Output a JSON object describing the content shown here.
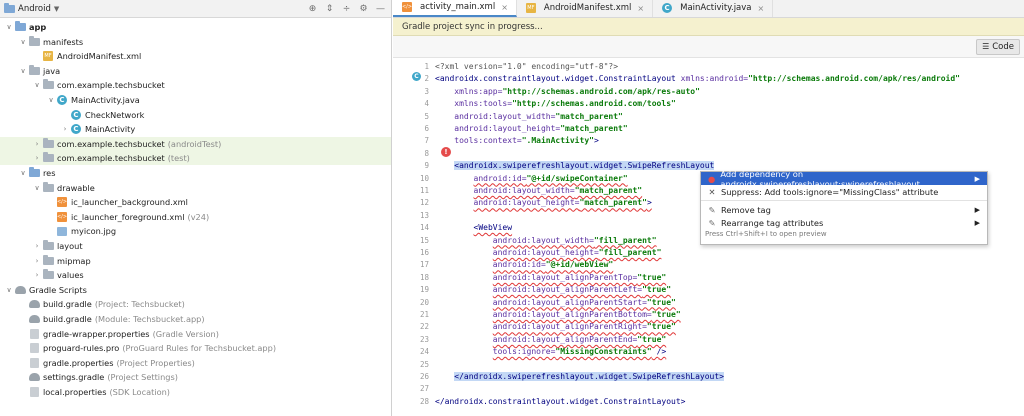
{
  "project_panel": {
    "title": "Android",
    "tree": [
      {
        "label": "app",
        "bold": true,
        "sub": "",
        "icon": "module-folder-icon",
        "indent": 0,
        "arrow": "down",
        "hl": false
      },
      {
        "label": "manifests",
        "sub": "",
        "icon": "folder-icon",
        "indent": 1,
        "arrow": "down",
        "hl": false
      },
      {
        "label": "AndroidManifest.xml",
        "sub": "",
        "icon": "manifest-file-icon",
        "indent": 2,
        "arrow": "",
        "hl": false
      },
      {
        "label": "java",
        "sub": "",
        "icon": "folder-icon",
        "indent": 1,
        "arrow": "down",
        "hl": false
      },
      {
        "label": "com.example.techsbucket",
        "sub": "",
        "icon": "package-icon",
        "indent": 2,
        "arrow": "down",
        "hl": false
      },
      {
        "label": "MainActivity.java",
        "sub": "",
        "icon": "java-class-icon",
        "indent": 3,
        "arrow": "down",
        "hl": false
      },
      {
        "label": "CheckNetwork",
        "sub": "",
        "icon": "java-class-icon",
        "indent": 4,
        "arrow": "",
        "hl": false
      },
      {
        "label": "MainActivity",
        "sub": "",
        "icon": "java-class-icon",
        "indent": 4,
        "arrow": "right",
        "hl": false
      },
      {
        "label": "com.example.techsbucket",
        "sub": "(androidTest)",
        "icon": "package-icon",
        "indent": 2,
        "arrow": "right",
        "hl": true
      },
      {
        "label": "com.example.techsbucket",
        "sub": "(test)",
        "icon": "package-icon",
        "indent": 2,
        "arrow": "right",
        "hl": true
      },
      {
        "label": "res",
        "sub": "",
        "icon": "res-folder-icon",
        "indent": 1,
        "arrow": "down",
        "hl": false
      },
      {
        "label": "drawable",
        "sub": "",
        "icon": "folder-icon",
        "indent": 2,
        "arrow": "down",
        "hl": false
      },
      {
        "label": "ic_launcher_background.xml",
        "sub": "",
        "icon": "xml-file-icon",
        "indent": 3,
        "arrow": "",
        "hl": false
      },
      {
        "label": "ic_launcher_foreground.xml",
        "sub": "(v24)",
        "icon": "xml-file-icon",
        "indent": 3,
        "arrow": "",
        "hl": false
      },
      {
        "label": "myicon.jpg",
        "sub": "",
        "icon": "image-file-icon",
        "indent": 3,
        "arrow": "",
        "hl": false
      },
      {
        "label": "layout",
        "sub": "",
        "icon": "folder-icon",
        "indent": 2,
        "arrow": "right",
        "hl": false
      },
      {
        "label": "mipmap",
        "sub": "",
        "icon": "folder-icon",
        "indent": 2,
        "arrow": "right",
        "hl": false
      },
      {
        "label": "values",
        "sub": "",
        "icon": "folder-icon",
        "indent": 2,
        "arrow": "right",
        "hl": false
      },
      {
        "label": "Gradle Scripts",
        "sub": "",
        "icon": "gradle-icon",
        "indent": 0,
        "arrow": "down",
        "hl": false
      },
      {
        "label": "build.gradle",
        "sub": "(Project: Techsbucket)",
        "icon": "gradle-icon",
        "indent": 1,
        "arrow": "",
        "hl": false
      },
      {
        "label": "build.gradle",
        "sub": "(Module: Techsbucket.app)",
        "icon": "gradle-icon",
        "indent": 1,
        "arrow": "",
        "hl": false
      },
      {
        "label": "gradle-wrapper.properties",
        "sub": "(Gradle Version)",
        "icon": "properties-file-icon",
        "indent": 1,
        "arrow": "",
        "hl": false
      },
      {
        "label": "proguard-rules.pro",
        "sub": "(ProGuard Rules for Techsbucket.app)",
        "icon": "properties-file-icon",
        "indent": 1,
        "arrow": "",
        "hl": false
      },
      {
        "label": "gradle.properties",
        "sub": "(Project Properties)",
        "icon": "properties-file-icon",
        "indent": 1,
        "arrow": "",
        "hl": false
      },
      {
        "label": "settings.gradle",
        "sub": "(Project Settings)",
        "icon": "gradle-icon",
        "indent": 1,
        "arrow": "",
        "hl": false
      },
      {
        "label": "local.properties",
        "sub": "(SDK Location)",
        "icon": "properties-file-icon",
        "indent": 1,
        "arrow": "",
        "hl": false
      }
    ]
  },
  "tabs": [
    {
      "label": "activity_main.xml",
      "icon": "xml-file-icon",
      "active": true
    },
    {
      "label": "AndroidManifest.xml",
      "icon": "manifest-file-icon",
      "active": false
    },
    {
      "label": "MainActivity.java",
      "icon": "java-class-icon",
      "active": false
    }
  ],
  "notice": "Gradle project sync in progress...",
  "code_mode_label": "Code",
  "code_lines": [
    {
      "n": "1",
      "indent": 0,
      "parts": [
        [
          "pi",
          "<?xml version=\"1.0\" encoding=\"utf-8\"?>"
        ]
      ]
    },
    {
      "n": "2",
      "indent": 0,
      "parts": [
        [
          "tg",
          "<androidx.constraintlayout.widget.ConstraintLayout "
        ],
        [
          "at",
          "xmlns:android="
        ],
        [
          "st",
          "\"http://schemas.android.com/apk/res/android\""
        ]
      ]
    },
    {
      "n": "3",
      "indent": 4,
      "parts": [
        [
          "at",
          "xmlns:app="
        ],
        [
          "st",
          "\"http://schemas.android.com/apk/res-auto\""
        ]
      ]
    },
    {
      "n": "4",
      "indent": 4,
      "parts": [
        [
          "at",
          "xmlns:tools="
        ],
        [
          "st",
          "\"http://schemas.android.com/tools\""
        ]
      ]
    },
    {
      "n": "5",
      "indent": 4,
      "parts": [
        [
          "at",
          "android:layout_width="
        ],
        [
          "st",
          "\"match_parent\""
        ]
      ]
    },
    {
      "n": "6",
      "indent": 4,
      "parts": [
        [
          "at",
          "android:layout_height="
        ],
        [
          "st",
          "\"match_parent\""
        ]
      ]
    },
    {
      "n": "7",
      "indent": 4,
      "parts": [
        [
          "at",
          "tools:context="
        ],
        [
          "st",
          "\".MainActivity\""
        ],
        [
          "tg",
          ">"
        ]
      ]
    },
    {
      "n": "8",
      "indent": 0,
      "parts": []
    },
    {
      "n": "9",
      "indent": 4,
      "sel": true,
      "parts": [
        [
          "tg",
          "<androidx.swiperefreshlayout.widget.SwipeRefreshLayout"
        ]
      ]
    },
    {
      "n": "10",
      "indent": 8,
      "warn": true,
      "parts": [
        [
          "at",
          "android:id="
        ],
        [
          "st",
          "\"@+id/swipeContainer\""
        ]
      ]
    },
    {
      "n": "11",
      "indent": 8,
      "warn": true,
      "parts": [
        [
          "at",
          "android:layout_width="
        ],
        [
          "st",
          "\"match_parent\""
        ]
      ]
    },
    {
      "n": "12",
      "indent": 8,
      "warn": true,
      "parts": [
        [
          "at",
          "android:layout_height="
        ],
        [
          "st",
          "\"match_parent\""
        ],
        [
          "tg",
          ">"
        ]
      ]
    },
    {
      "n": "13",
      "indent": 0,
      "parts": []
    },
    {
      "n": "14",
      "indent": 8,
      "warn": true,
      "parts": [
        [
          "tg",
          "<WebView"
        ]
      ]
    },
    {
      "n": "15",
      "indent": 12,
      "warn": true,
      "parts": [
        [
          "at",
          "android:layout_width="
        ],
        [
          "st",
          "\"fill_parent\""
        ]
      ]
    },
    {
      "n": "16",
      "indent": 12,
      "warn": true,
      "parts": [
        [
          "at",
          "android:layout_height="
        ],
        [
          "st",
          "\"fill_parent\""
        ]
      ]
    },
    {
      "n": "17",
      "indent": 12,
      "warn": true,
      "parts": [
        [
          "at",
          "android:id="
        ],
        [
          "st",
          "\"@+id/webView\""
        ]
      ]
    },
    {
      "n": "18",
      "indent": 12,
      "warn": true,
      "parts": [
        [
          "at",
          "android:layout_alignParentTop="
        ],
        [
          "st",
          "\"true\""
        ]
      ]
    },
    {
      "n": "19",
      "indent": 12,
      "warn": true,
      "parts": [
        [
          "at",
          "android:layout_alignParentLeft="
        ],
        [
          "st",
          "\"true\""
        ]
      ]
    },
    {
      "n": "20",
      "indent": 12,
      "warn": true,
      "parts": [
        [
          "at",
          "android:layout_alignParentStart="
        ],
        [
          "st",
          "\"true\""
        ]
      ]
    },
    {
      "n": "21",
      "indent": 12,
      "warn": true,
      "parts": [
        [
          "at",
          "android:layout_alignParentBottom="
        ],
        [
          "st",
          "\"true\""
        ]
      ]
    },
    {
      "n": "22",
      "indent": 12,
      "warn": true,
      "parts": [
        [
          "at",
          "android:layout_alignParentRight="
        ],
        [
          "st",
          "\"true\""
        ]
      ]
    },
    {
      "n": "23",
      "indent": 12,
      "warn": true,
      "parts": [
        [
          "at",
          "android:layout_alignParentEnd="
        ],
        [
          "st",
          "\"true\""
        ]
      ]
    },
    {
      "n": "24",
      "indent": 12,
      "warn": true,
      "parts": [
        [
          "at",
          "tools:ignore="
        ],
        [
          "st",
          "\"MissingConstraints\""
        ],
        [
          "tg",
          " />"
        ]
      ]
    },
    {
      "n": "25",
      "indent": 0,
      "parts": []
    },
    {
      "n": "26",
      "indent": 4,
      "sel": true,
      "parts": [
        [
          "tg",
          "</androidx.swiperefreshlayout.widget.SwipeRefreshLayout>"
        ]
      ]
    },
    {
      "n": "27",
      "indent": 0,
      "parts": []
    },
    {
      "n": "28",
      "indent": 0,
      "parts": [
        [
          "tg",
          "</androidx.constraintlayout.widget.ConstraintLayout>"
        ]
      ]
    }
  ],
  "popup": {
    "items": [
      {
        "label": "Add dependency on androidx.swiperefreshlayout:swiperefreshlayout",
        "icon": "error-bulb-icon",
        "active": true,
        "submenu": true
      },
      {
        "label": "Suppress: Add tools:ignore=\"MissingClass\" attribute",
        "icon": "suppress-icon",
        "active": false,
        "submenu": false
      },
      {
        "label": "Remove tag",
        "icon": "edit-icon",
        "active": false,
        "submenu": true
      },
      {
        "label": "Rearrange tag attributes",
        "icon": "edit-icon",
        "active": false,
        "submenu": true
      }
    ],
    "hint": "Press Ctrl+Shift+I to open preview"
  },
  "colors": {
    "accent": "#2f65ca",
    "notice_bg": "#f5f1cf",
    "selection": "#c3d8f5",
    "tag": "#000080",
    "attr": "#5a2fa0",
    "string": "#0a7a0a"
  }
}
